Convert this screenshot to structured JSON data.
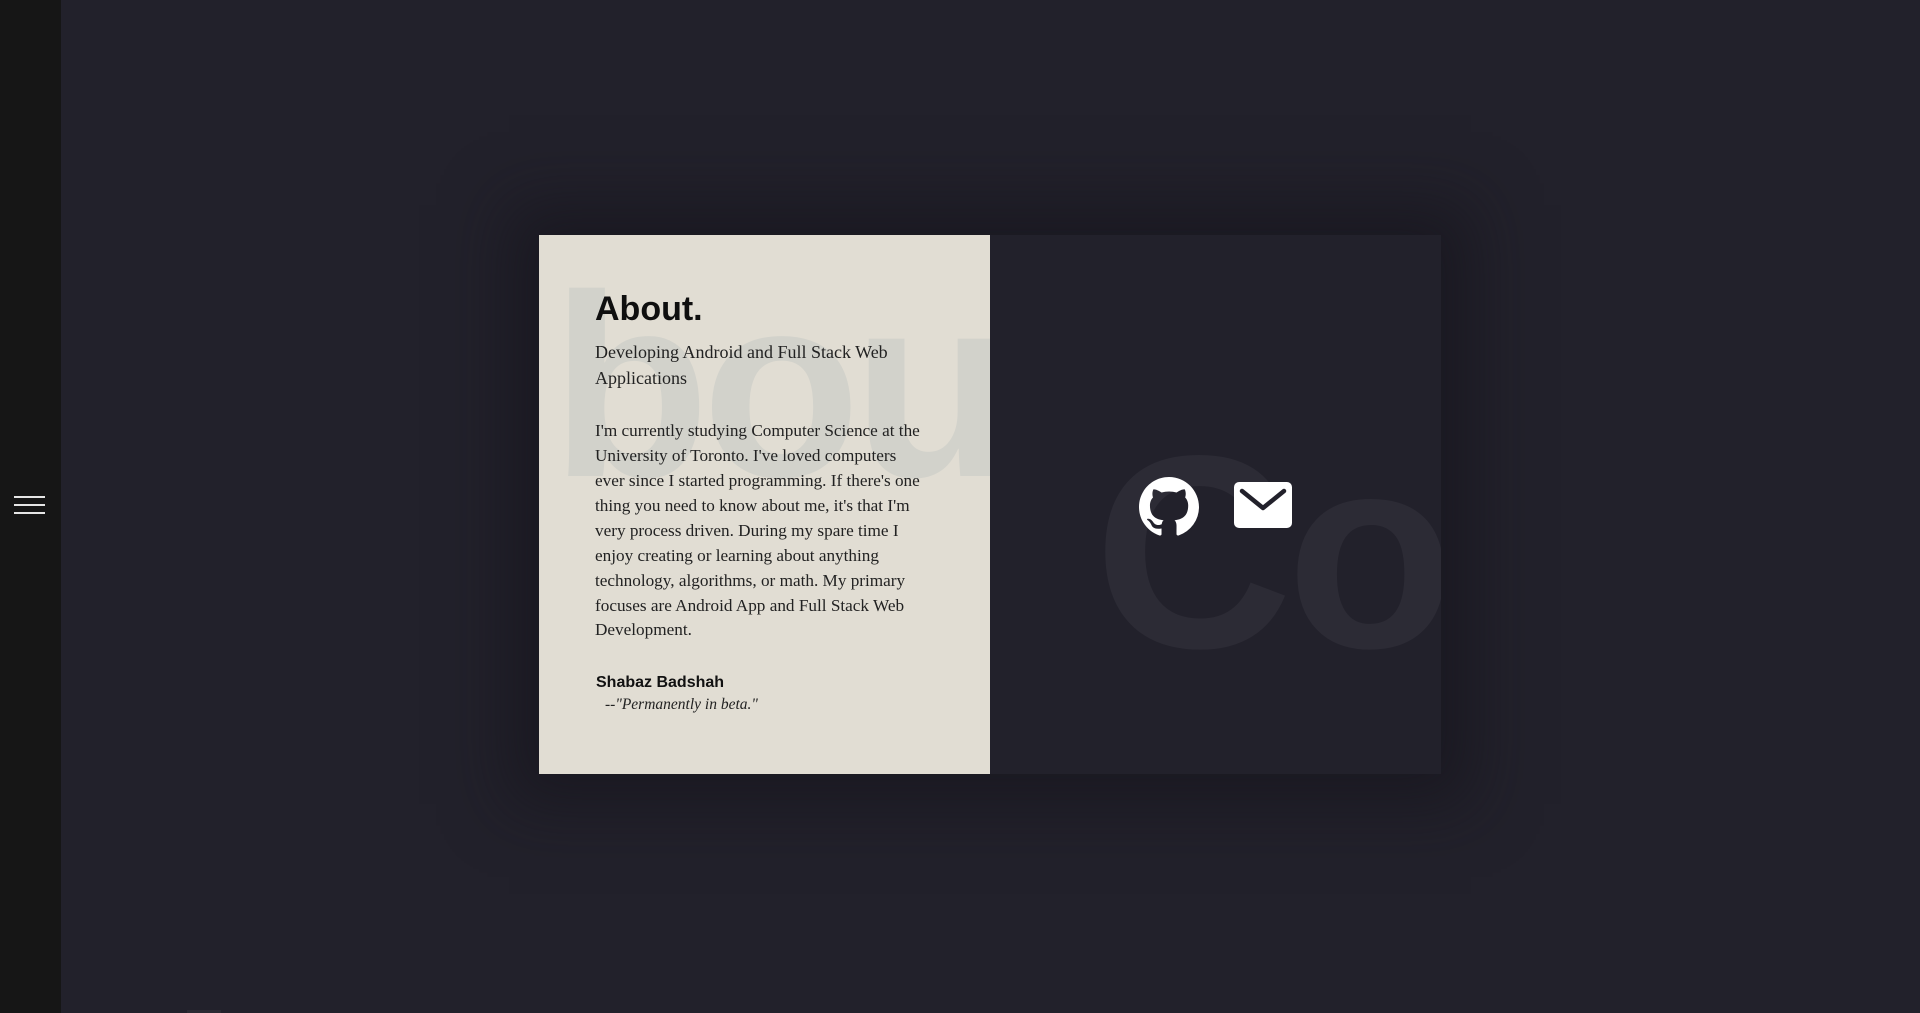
{
  "nav": {
    "menu_icon": "hamburger-menu-icon"
  },
  "about": {
    "watermark": "bout",
    "title": "About.",
    "subtitle": "Developing Android and Full Stack Web Applications",
    "body": "I'm currently studying Computer Science at the University of Toronto. I've loved computers ever since I started programming. If there's one thing you need to know about me, it's that I'm very process driven. During my spare time I enjoy creating or learning about anything technology, algorithms, or math. My primary focuses are Android App and Full Stack Web Development.",
    "name": "Shabaz Badshah",
    "quote": "--\"Permanently in beta.\""
  },
  "contact": {
    "watermark": "Co",
    "links": [
      {
        "icon": "github-icon"
      },
      {
        "icon": "mail-icon"
      }
    ]
  },
  "colors": {
    "background": "#22212b",
    "sidebar": "#161616",
    "about_panel": "#e1ddd3",
    "icon": "#ffffff"
  }
}
